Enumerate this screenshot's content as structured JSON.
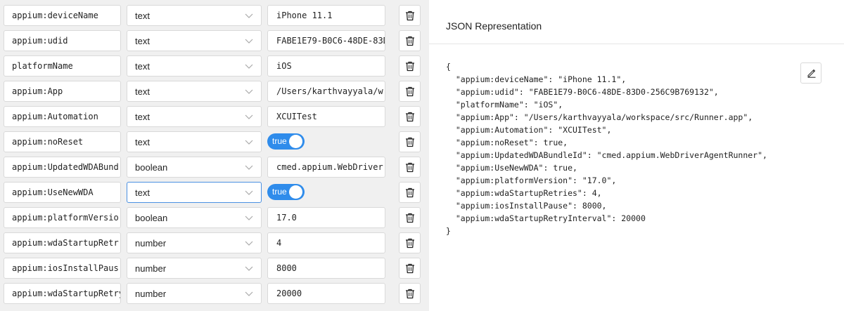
{
  "capabilities": [
    {
      "name": "appium:deviceName",
      "type": "text",
      "value": "iPhone 11.1",
      "value_kind": "input"
    },
    {
      "name": "appium:udid",
      "type": "text",
      "value": "FABE1E79-B0C6-48DE-83D",
      "value_kind": "input"
    },
    {
      "name": "platformName",
      "type": "text",
      "value": "iOS",
      "value_kind": "input"
    },
    {
      "name": "appium:App",
      "type": "text",
      "value": "/Users/karthvayyala/w",
      "value_kind": "input"
    },
    {
      "name": "appium:Automation",
      "type": "text",
      "value": "XCUITest",
      "value_kind": "input"
    },
    {
      "name": "appium:noReset",
      "type": "text",
      "value": "true",
      "value_kind": "toggle"
    },
    {
      "name": "appium:UpdatedWDABund",
      "type": "boolean",
      "value": "cmed.appium.WebDriver",
      "value_kind": "input"
    },
    {
      "name": "appium:UseNewWDA",
      "type": "text",
      "value": "true",
      "value_kind": "toggle",
      "focused": true
    },
    {
      "name": "appium:platformVersio",
      "type": "boolean",
      "value": "17.0",
      "value_kind": "input"
    },
    {
      "name": "appium:wdaStartupRetr",
      "type": "number",
      "value": "4",
      "value_kind": "input"
    },
    {
      "name": "appium:iosInstallPaus",
      "type": "number",
      "value": "8000",
      "value_kind": "input"
    },
    {
      "name": "appium:wdaStartupRetry",
      "type": "number",
      "value": "20000",
      "value_kind": "input"
    }
  ],
  "json_panel": {
    "title": "JSON Representation",
    "lines": [
      "{",
      "  \"appium:deviceName\": \"iPhone 11.1\",",
      "  \"appium:udid\": \"FABE1E79-B0C6-48DE-83D0-256C9B769132\",",
      "  \"platformName\": \"iOS\",",
      "  \"appium:App\": \"/Users/karthvayyala/workspace/src/Runner.app\",",
      "  \"appium:Automation\": \"XCUITest\",",
      "  \"appium:noReset\": true,",
      "  \"appium:UpdatedWDABundleId\": \"cmed.appium.WebDriverAgentRunner\",",
      "  \"appium:UseNewWDA\": true,",
      "  \"appium:platformVersion\": \"17.0\",",
      "  \"appium:wdaStartupRetries\": 4,",
      "  \"appium:iosInstallPause\": 8000,",
      "  \"appium:wdaStartupRetryInterval\": 20000",
      "}"
    ],
    "edit_icon": "pencil-icon"
  },
  "icons": {
    "delete": "trash-icon",
    "dropdown": "chevron-down-icon"
  },
  "colors": {
    "toggle_on": "#2f8ceb",
    "focus_border": "#4a90e2"
  }
}
